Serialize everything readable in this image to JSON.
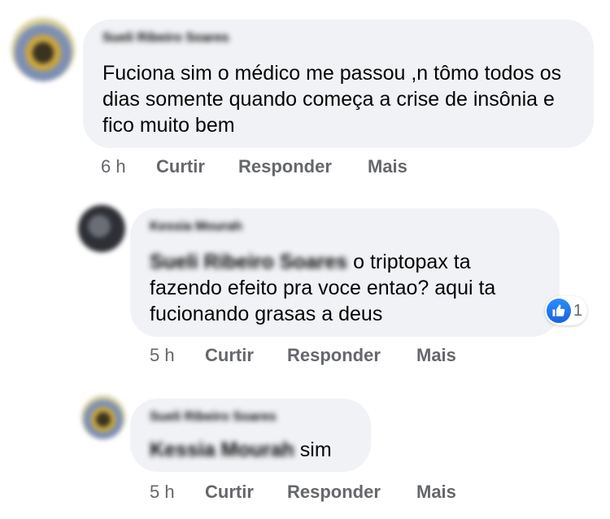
{
  "comments": [
    {
      "author": "Sueli Ribeiro Soares",
      "text": "Fuciona sim o médico me passou ,n tômo todos os dias somente quando começa a crise de insônia e fico muito bem",
      "time": "6 h",
      "actions": {
        "like": "Curtir",
        "reply": "Responder",
        "more": "Mais"
      }
    },
    {
      "author": "Kessia Mourah",
      "mention": "Sueli Ribeiro Soares",
      "text": "o triptopax ta fazendo efeito pra voce entao? aqui ta fucionando grasas a deus",
      "time": "5 h",
      "reactions": {
        "icon": "like-icon",
        "count": "1"
      },
      "actions": {
        "like": "Curtir",
        "reply": "Responder",
        "more": "Mais"
      }
    },
    {
      "author": "Sueli Ribeiro Soares",
      "mention": "Kessia Mourah",
      "text": "sim",
      "time": "5 h",
      "actions": {
        "like": "Curtir",
        "reply": "Responder",
        "more": "Mais"
      }
    }
  ]
}
